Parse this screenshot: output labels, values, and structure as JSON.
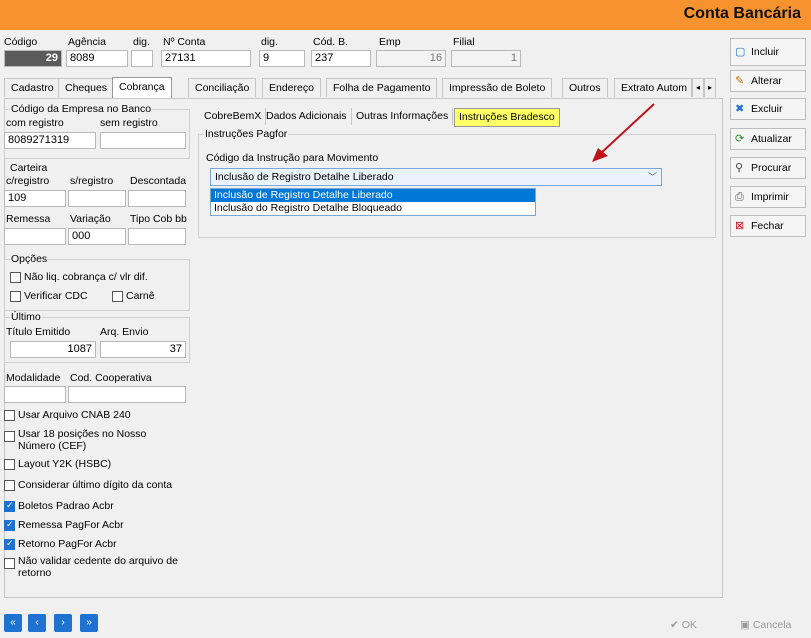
{
  "window": {
    "title": "Conta Bancária"
  },
  "header": {
    "codigo_label": "Código",
    "codigo_value": "29",
    "agencia_label": "Agência",
    "agencia_value": "8089",
    "dig1_label": "dig.",
    "dig1_value": "",
    "nconta_label": "Nº Conta",
    "nconta_value": "27131",
    "dig2_label": "dig.",
    "dig2_value": "9",
    "codb_label": "Cód. B.",
    "codb_value": "237",
    "emp_label": "Emp",
    "emp_value": "16",
    "filial_label": "Filial",
    "filial_value": "1"
  },
  "tabs": [
    "Cadastro",
    "Cheques",
    "Cobrança",
    "Conciliação",
    "Endereço",
    "Folha de Pagamento",
    "Impressão de Boleto",
    "Outros",
    "Extrato Autom"
  ],
  "active_tab": "Cobrança",
  "cobranca": {
    "empresa_group": "Código da Empresa no Banco",
    "com_registro_label": "com registro",
    "com_registro_value": "8089271319",
    "sem_registro_label": "sem registro",
    "sem_registro_value": "",
    "carteira_group": "Carteira",
    "c_registro_label": "c/registro",
    "c_registro_value": "109",
    "s_registro_label": "s/registro",
    "s_registro_value": "",
    "descontada_label": "Descontada",
    "descontada_value": "",
    "remessa_label": "Remessa",
    "remessa_value": "",
    "variacao_label": "Variação",
    "variacao_value": "000",
    "tipo_cob_label": "Tipo Cob bb",
    "tipo_cob_value": "",
    "opcoes_group": "Opções",
    "nao_liq_label": "Não liq. cobrança c/ vlr dif.",
    "verificar_cdc_label": "Verificar CDC",
    "carne_label": "Carnê",
    "ultimo_group": "Último",
    "titulo_emitido_label": "Título Emitido",
    "titulo_emitido_value": "1087",
    "arq_envio_label": "Arq. Envio",
    "arq_envio_value": "37",
    "modalidade_label": "Modalidade",
    "modalidade_value": "",
    "cod_cooperativa_label": "Cod. Cooperativa",
    "cod_cooperativa_value": "",
    "checks": [
      {
        "label": "Usar Arquivo CNAB 240",
        "checked": false
      },
      {
        "label": "Usar 18 posições no Nosso Número (CEF)",
        "checked": false
      },
      {
        "label": "Layout Y2K (HSBC)",
        "checked": false
      },
      {
        "label": "Considerar último dígito da conta",
        "checked": false
      },
      {
        "label": "Boletos Padrao Acbr",
        "checked": true
      },
      {
        "label": "Remessa PagFor Acbr",
        "checked": true
      },
      {
        "label": "Retorno PagFor Acbr",
        "checked": true
      },
      {
        "label": "Não validar cedente do arquivo de retorno",
        "checked": false
      }
    ]
  },
  "subtabs": [
    "CobreBemX",
    "Dados Adicionais",
    "Outras Informações",
    "Instruções Bradesco"
  ],
  "active_subtab": "Instruções Bradesco",
  "instrucoes": {
    "group_label": "Instruções Pagfor",
    "field_label": "Código da Instrução para Movimento",
    "selected": "Inclusão de Registro Detalhe Liberado",
    "options": [
      "Inclusão de Registro Detalhe Liberado",
      "Inclusão do Registro Detalhe Bloqueado"
    ]
  },
  "sidebar_buttons": [
    "Incluir",
    "Alterar",
    "Excluir",
    "Atualizar",
    "Procurar",
    "Imprimir",
    "Fechar"
  ],
  "bottom": {
    "ok_label": "OK",
    "cancel_label": "Cancela"
  },
  "colors": {
    "titlebar": "#f7932f",
    "highlight_tab": "#ffff66",
    "arrow": "#c0141c",
    "accent": "#1e73d2"
  }
}
